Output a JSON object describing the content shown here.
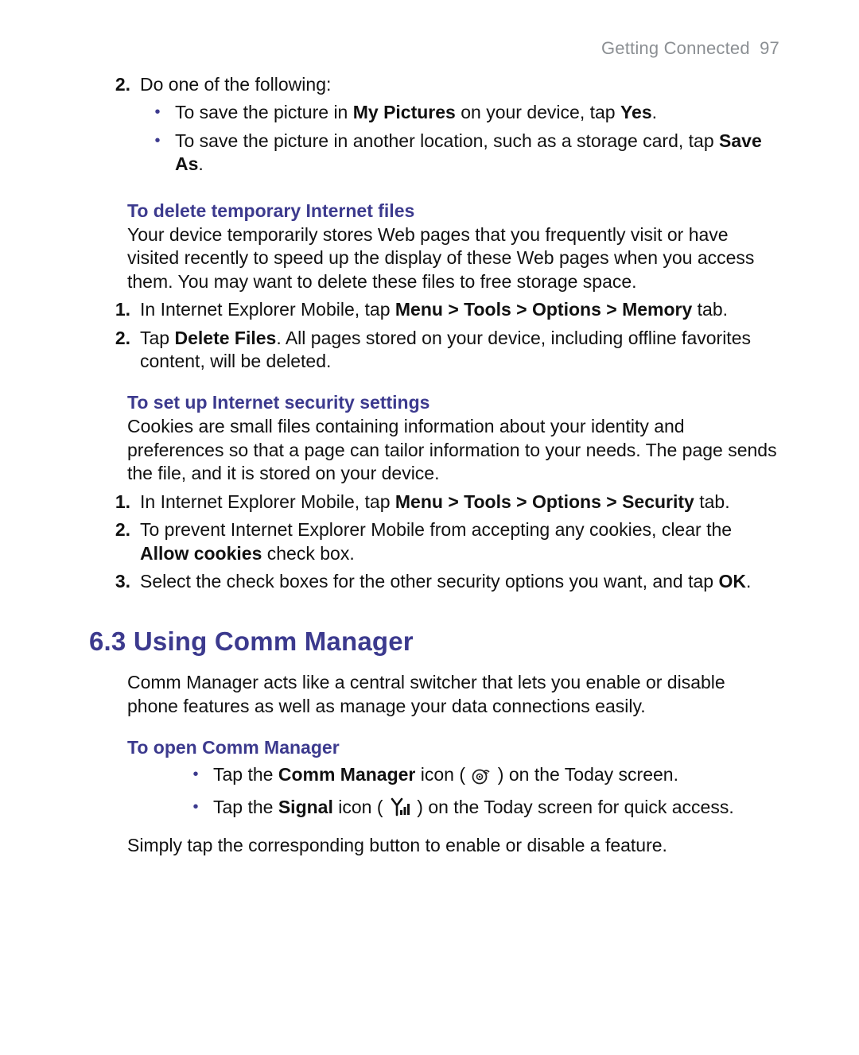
{
  "header": {
    "chapter": "Getting Connected",
    "page_number": "97"
  },
  "step2": {
    "number": "2.",
    "lead": "Do one of the following:",
    "bullets": [
      {
        "pre": "To save the picture in ",
        "bold1": "My Pictures",
        "mid": " on your device, tap ",
        "bold2": "Yes",
        "post": "."
      },
      {
        "pre": "To save the picture in another location, such as a storage card, tap ",
        "bold1": "Save As",
        "mid": "",
        "bold2": "",
        "post": "."
      }
    ]
  },
  "deleteTemp": {
    "heading": "To delete temporary Internet files",
    "intro": "Your device temporarily stores Web pages that you frequently visit or have visited recently to speed up the display of these Web pages when you access them. You may want to delete these files to free storage space.",
    "steps": [
      {
        "num": "1.",
        "pre": "In Internet Explorer Mobile, tap ",
        "bold": "Menu > Tools > Options > Memory",
        "post": " tab."
      },
      {
        "num": "2.",
        "pre": "Tap ",
        "bold": "Delete Files",
        "post": ". All pages stored on your device, including offline favorites content, will be deleted."
      }
    ]
  },
  "security": {
    "heading": "To set up Internet security settings",
    "intro": "Cookies are small files containing information about your identity and preferences so that a page can tailor information to your needs. The page sends the file, and it is stored on your device.",
    "steps": [
      {
        "num": "1.",
        "pre": "In Internet Explorer Mobile, tap ",
        "bold": "Menu > Tools > Options > Security",
        "post": " tab."
      },
      {
        "num": "2.",
        "pre": "To prevent Internet Explorer Mobile from accepting any cookies, clear the ",
        "bold": "Allow cookies",
        "post": " check box."
      },
      {
        "num": "3.",
        "pre": "Select the check boxes for the other security options you want, and tap ",
        "bold": "OK",
        "post": "."
      }
    ]
  },
  "section63": {
    "number": "6.3",
    "title": "Using Comm Manager",
    "intro": "Comm Manager acts like a central switcher that lets you enable or disable phone features as well as manage your data connections easily.",
    "openHeading": "To open Comm Manager",
    "bullets": [
      {
        "pre": "Tap the ",
        "bold": "Comm Manager",
        "mid": " icon ( ",
        "iconName": "comm-manager-icon",
        "post": " ) on the Today screen."
      },
      {
        "pre": "Tap the ",
        "bold": "Signal",
        "mid": " icon ( ",
        "iconName": "signal-icon",
        "post": " ) on the Today screen for quick access."
      }
    ],
    "closing": "Simply tap the corresponding button to enable or disable a feature."
  }
}
